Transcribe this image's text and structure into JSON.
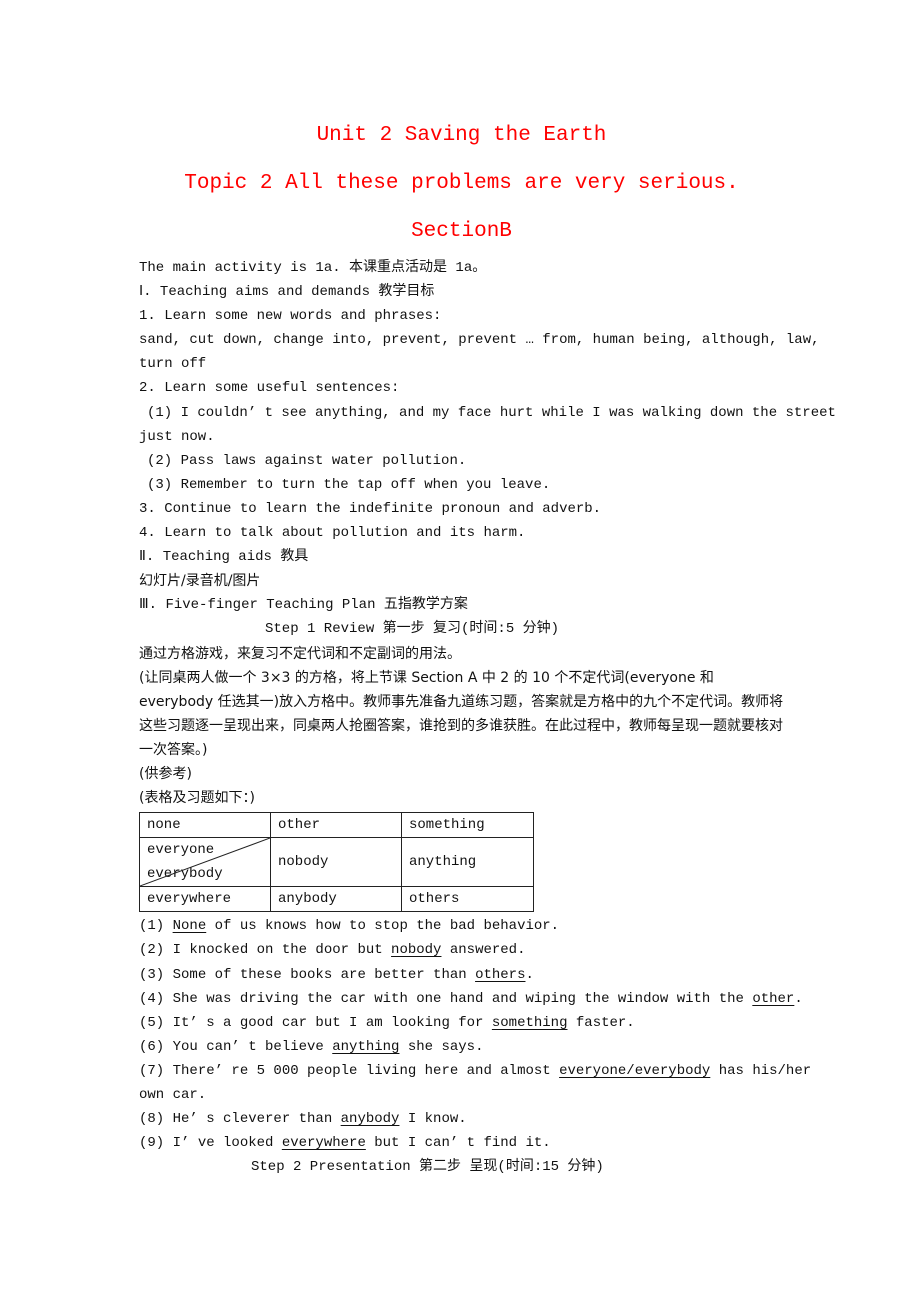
{
  "titles": {
    "unit": "Unit 2  Saving the Earth",
    "topic": "Topic 2  All these problems are very serious.",
    "section": "SectionB"
  },
  "title_color": "#ff0000",
  "lines": {
    "main_activity": "The main activity is 1a. 本课重点活动是 1a。",
    "aims_heading": "Ⅰ. Teaching aims and demands 教学目标",
    "aim1": "1. Learn some new words and phrases:",
    "aim1_words": "sand, cut down, change into, prevent, prevent … from, human being, although, law,",
    "aim1_words_cont": "turn off",
    "aim2": "2. Learn some useful sentences:",
    "aim2_s1": "(1) I couldn’ t see anything, and my face hurt while I was walking down the street",
    "aim2_s1_cont": "just now.",
    "aim2_s2": "(2) Pass laws against water pollution.",
    "aim2_s3": "(3) Remember to turn the tap off when you leave.",
    "aim3": "3. Continue to learn the indefinite pronoun and adverb.",
    "aim4": "4. Learn to talk about pollution and its harm.",
    "aids_heading": "Ⅱ. Teaching aids 教具",
    "aids": "幻灯片/录音机/图片",
    "plan_heading": "Ⅲ. Five-finger Teaching Plan 五指教学方案",
    "step1": "Step 1  Review 第一步  复习(时间:5 分钟)",
    "step1_desc": "通过方格游戏，来复习不定代词和不定副词的用法。",
    "step1_detail": "(让同桌两人做一个 3×3 的方格，将上节课 Section A 中 2 的 10 个不定代词(everyone 和 everybody 任选其一)放入方格中。教师事先准备九道练习题，答案就是方格中的九个不定代词。教师将这些习题逐一呈现出来，同桌两人抢圈答案，谁抢到的多谁获胜。在此过程中，教师每呈现一题就要核对一次答案。)",
    "reference": "(供参考)",
    "table_intro": "(表格及习题如下：)",
    "step2": "Step 2  Presentation 第二步  呈现(时间:15 分钟)"
  },
  "grid": {
    "row1": [
      "none",
      "other",
      "something"
    ],
    "row2": [
      "everyone",
      "everybody",
      "nobody",
      "anything"
    ],
    "row3": [
      "everywhere",
      "anybody",
      "others"
    ]
  },
  "exercises": [
    {
      "num": "(1) ",
      "before": "",
      "answer": "None",
      "after": " of us knows how to stop the bad behavior."
    },
    {
      "num": "(2) ",
      "before": "I knocked on the door but ",
      "answer": "nobody",
      "after": " answered."
    },
    {
      "num": "(3) ",
      "before": "Some of these books are better than ",
      "answer": "others",
      "after": "."
    },
    {
      "num": "(4) ",
      "before": "She was driving the car with one hand and wiping the window with the ",
      "answer": "other",
      "after": "."
    },
    {
      "num": "(5) ",
      "before": "It’ s a good car but I am looking for ",
      "answer": "something",
      "after": " faster."
    },
    {
      "num": "(6) ",
      "before": "You can’ t believe ",
      "answer": "anything",
      "after": " she says."
    },
    {
      "num": "(7) ",
      "before": "There’ re 5 000 people living here and almost ",
      "answer": "everyone/everybody",
      "after": " has his/her"
    },
    {
      "num": "(8) ",
      "before": "He’ s cleverer than ",
      "answer": "anybody",
      "after": " I know."
    },
    {
      "num": "(9) ",
      "before": "I’ ve looked ",
      "answer": "everywhere",
      "after": " but I can’ t find it."
    }
  ],
  "exercise7_cont": "own car."
}
